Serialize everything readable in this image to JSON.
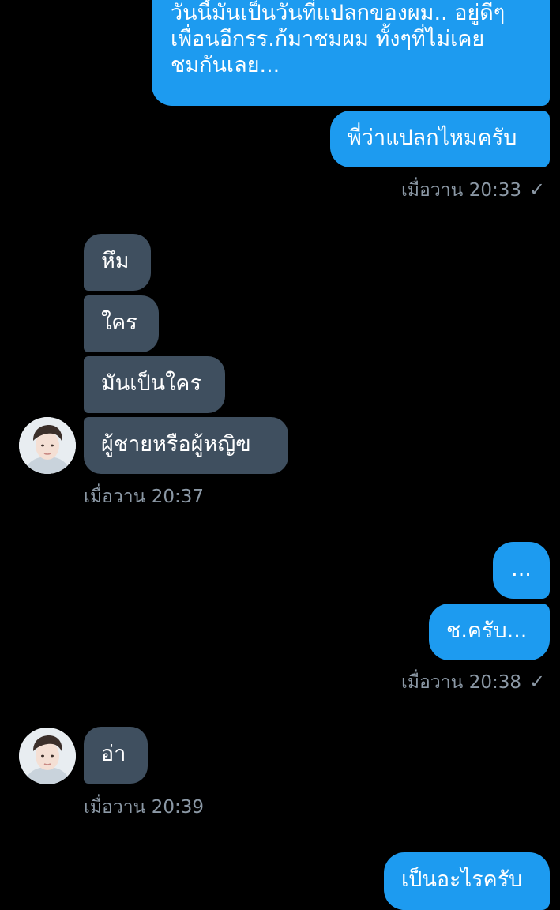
{
  "colors": {
    "background": "#000000",
    "sent_bubble": "#1d9bf0",
    "received_bubble": "#3f4f5f",
    "meta_text": "#8b98a5"
  },
  "messages": {
    "m1_line1": "วันนี้มันเป็นวันที่แปลกของผม.. อยู่ดีๆ",
    "m1_line2": "เพื่อนอีกรร.ก้มาชมผม ทั้งๆที่ไม่เคย",
    "m1_line3": "ชมกันเลย...",
    "m2": "พี่ว่าแปลกไหมครับ",
    "m2_time": "เมื่อวาน 20:33",
    "r1": "หึม",
    "r2": "ใคร",
    "r3": "มันเป็นใคร",
    "r4": "ผู้ชายหรือผู้หญิฃ",
    "r4_time": "เมื่อวาน 20:37",
    "m3": "...",
    "m4": "ช.ครับ...",
    "m4_time": "เมื่อวาน 20:38",
    "r5": "อ่า",
    "r5_time": "เมื่อวาน 20:39",
    "m5": "เป็นอะไรครับ"
  },
  "icons": {
    "read_check": "check-icon",
    "check_glyph": "✓",
    "avatar": "avatar"
  }
}
